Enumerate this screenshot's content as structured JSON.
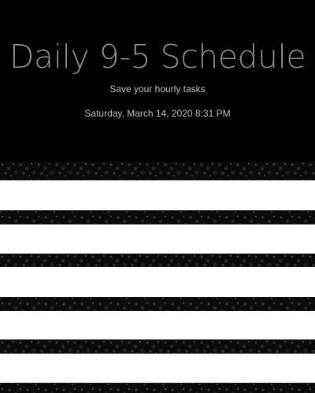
{
  "header": {
    "title": "Daily 9-5 Schedule",
    "subtitle": "Save your hourly tasks",
    "timestamp": "Saturday, March 14, 2020 8:31 PM"
  },
  "colors": {
    "header_background": "#000000",
    "title": "#8c8c8c",
    "text": "#bdbdbd",
    "stripe": "#0b0b0b",
    "row_background": "#ffffff"
  }
}
